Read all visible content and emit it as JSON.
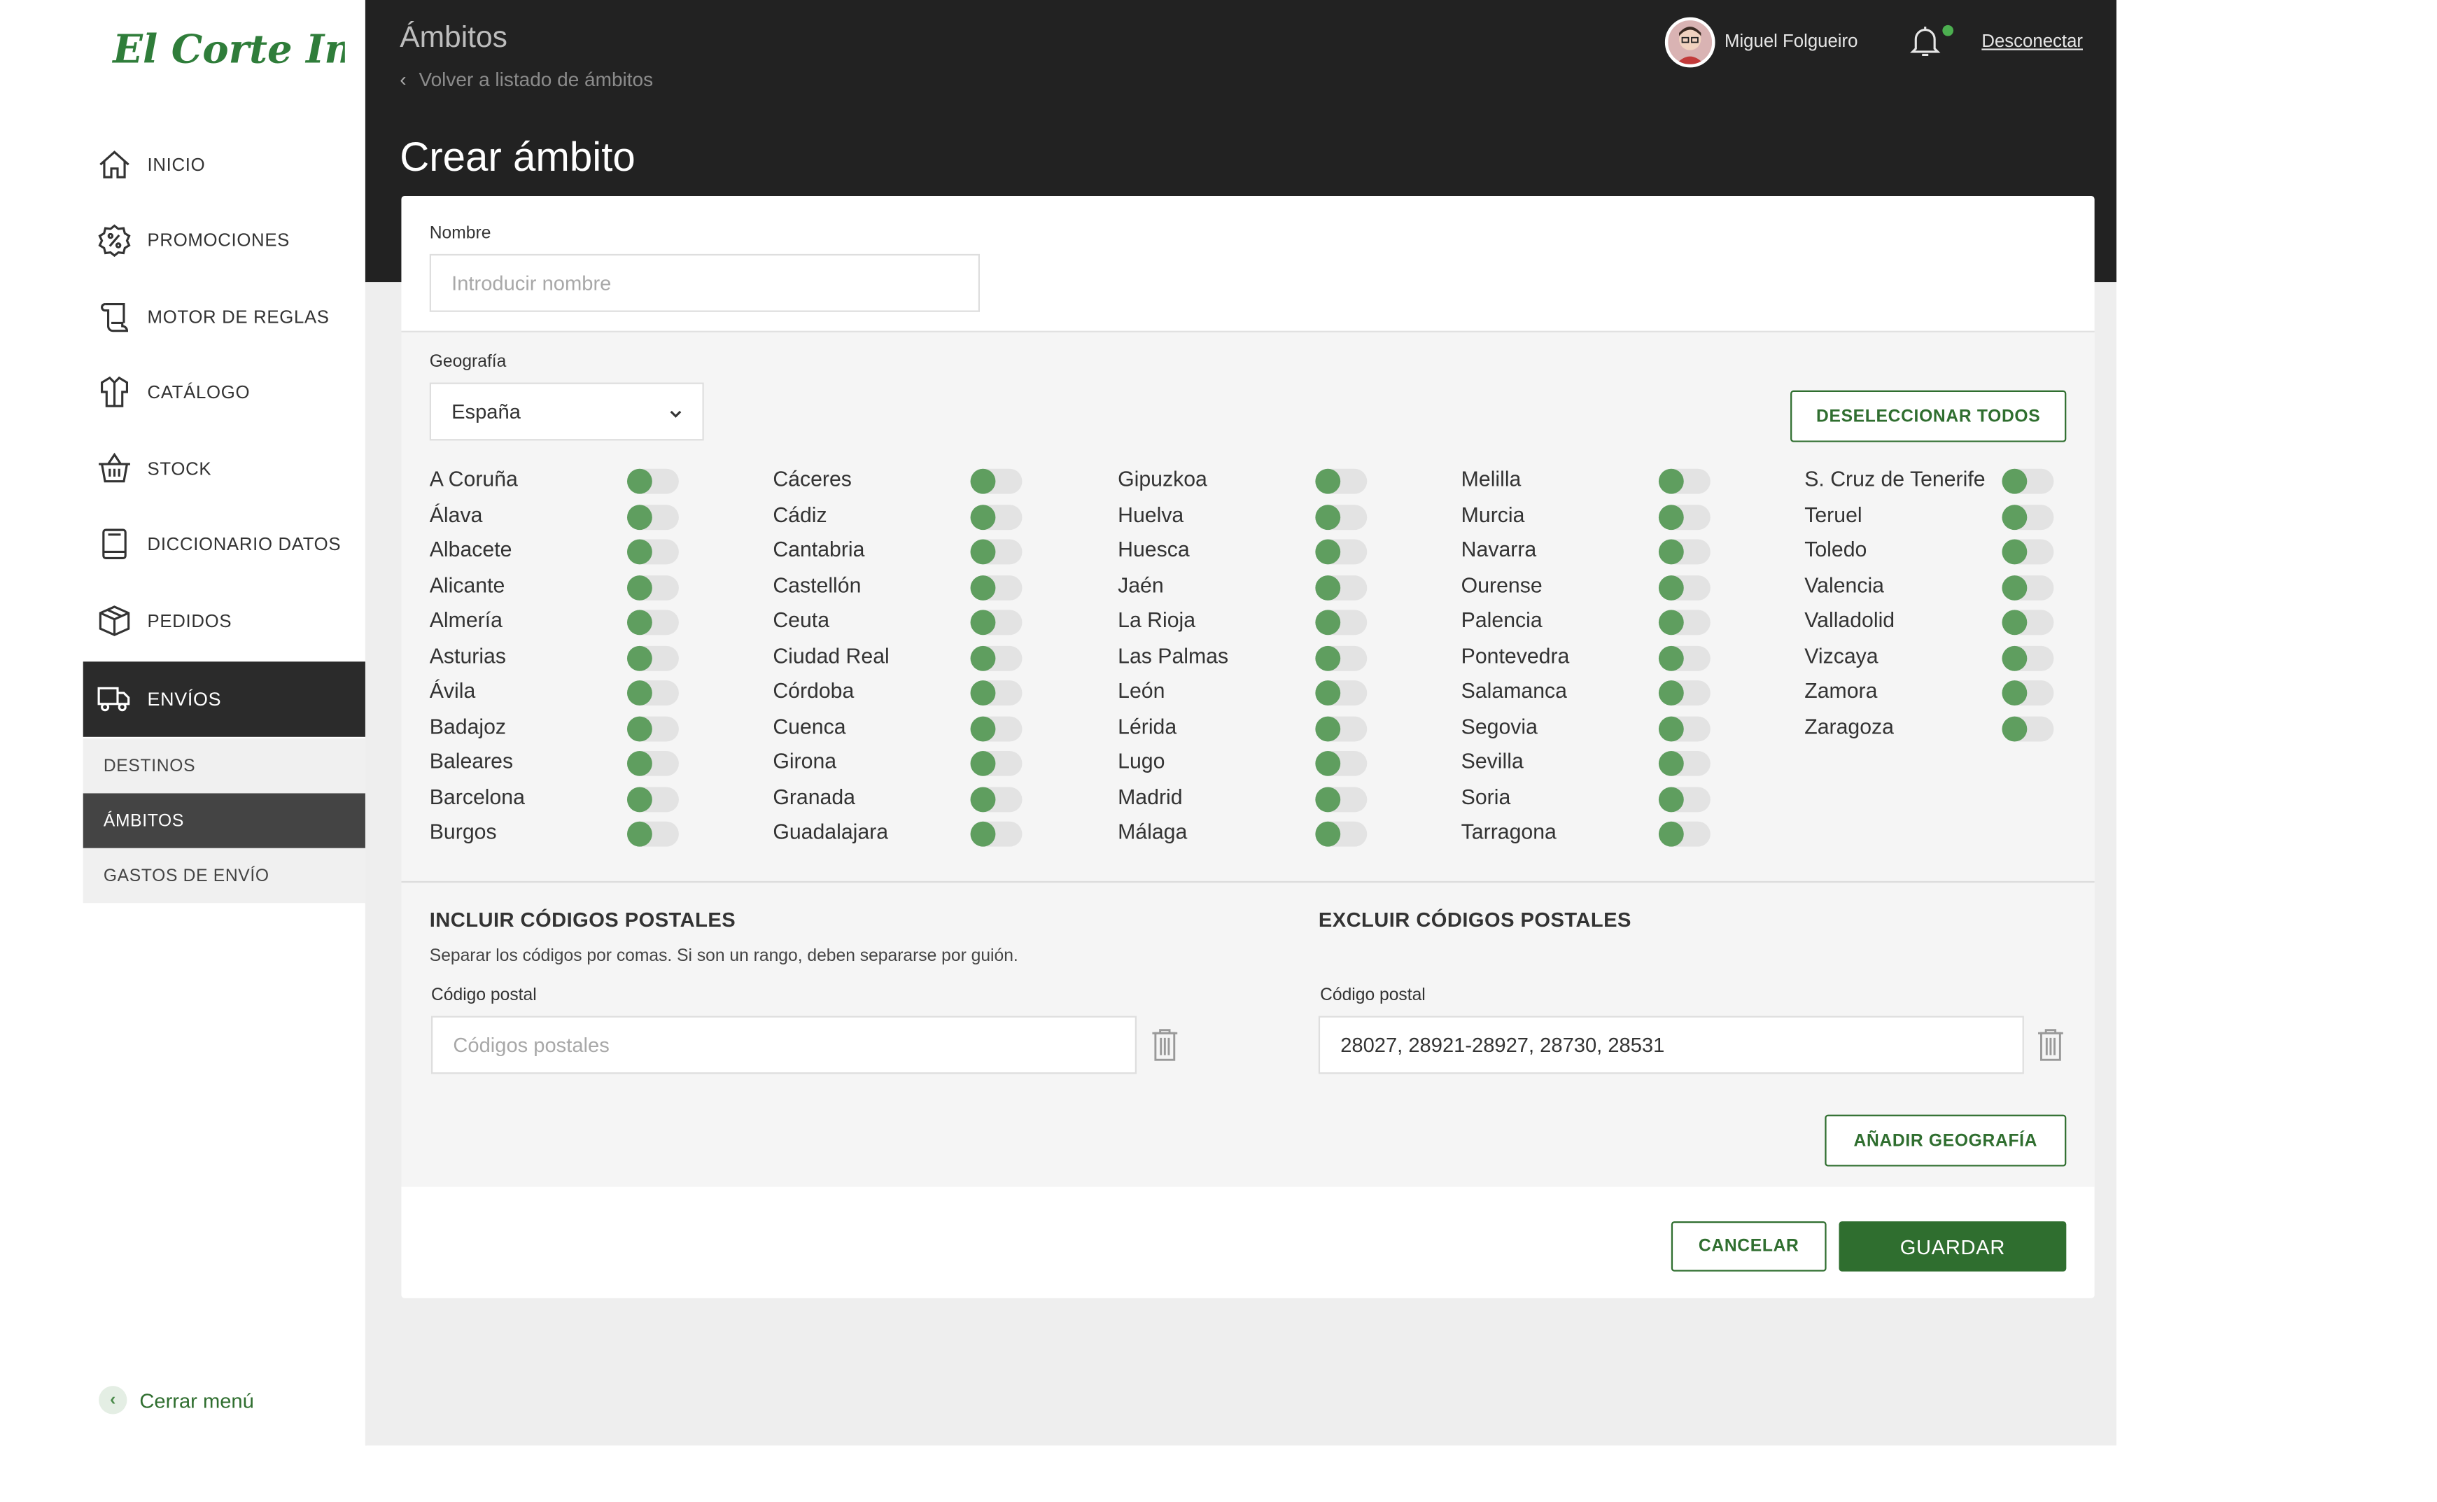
{
  "colors": {
    "brand_green": "#2f6e2f",
    "header_bg": "#222222",
    "toggle_on": "#5f9e5f"
  },
  "sidebar": {
    "logo_text": "El Corte Inglés",
    "items": [
      {
        "label": "INICIO",
        "icon": "home-icon"
      },
      {
        "label": "PROMOCIONES",
        "icon": "percent-badge-icon"
      },
      {
        "label": "MOTOR DE REGLAS",
        "icon": "scroll-icon"
      },
      {
        "label": "CATÁLOGO",
        "icon": "shirt-icon"
      },
      {
        "label": "STOCK",
        "icon": "basket-icon"
      },
      {
        "label": "DICCIONARIO DATOS",
        "icon": "book-icon"
      },
      {
        "label": "PEDIDOS",
        "icon": "box-icon"
      },
      {
        "label": "ENVÍOS",
        "icon": "truck-icon"
      }
    ],
    "subitems": [
      {
        "label": "DESTINOS"
      },
      {
        "label": "ÁMBITOS"
      },
      {
        "label": "GASTOS DE ENVÍO"
      }
    ],
    "close_menu": "Cerrar menú"
  },
  "header": {
    "section": "Ámbitos",
    "back": "Volver a listado de ámbitos",
    "title": "Crear ámbito",
    "user_name": "Miguel Folgueiro",
    "logout": "Desconectar"
  },
  "form": {
    "name_label": "Nombre",
    "name_placeholder": "Introducir nombre",
    "geo_label": "Geografía",
    "geo_value": "España",
    "deselect_all": "DESELECCIONAR TODOS",
    "provinces": [
      [
        "A Coruña",
        "Álava",
        "Albacete",
        "Alicante",
        "Almería",
        "Asturias",
        "Ávila",
        "Badajoz",
        "Baleares",
        "Barcelona",
        "Burgos"
      ],
      [
        "Cáceres",
        "Cádiz",
        "Cantabria",
        "Castellón",
        "Ceuta",
        "Ciudad Real",
        "Córdoba",
        "Cuenca",
        "Girona",
        "Granada",
        "Guadalajara"
      ],
      [
        "Gipuzkoa",
        "Huelva",
        "Huesca",
        "Jaén",
        "La Rioja",
        "Las Palmas",
        "León",
        "Lérida",
        "Lugo",
        "Madrid",
        "Málaga"
      ],
      [
        "Melilla",
        "Murcia",
        "Navarra",
        "Ourense",
        "Palencia",
        "Pontevedra",
        "Salamanca",
        "Segovia",
        "Sevilla",
        "Soria",
        "Tarragona"
      ],
      [
        "S. Cruz de Tenerife",
        "Teruel",
        "Toledo",
        "Valencia",
        "Valladolid",
        "Vizcaya",
        "Zamora",
        "Zaragoza"
      ]
    ],
    "include": {
      "title": "INCLUIR CÓDIGOS POSTALES",
      "hint": "Separar los códigos por comas. Si son un rango, deben separarse por guión.",
      "label": "Código postal",
      "placeholder": "Códigos postales"
    },
    "exclude": {
      "title": "EXCLUIR CÓDIGOS POSTALES",
      "label": "Código postal",
      "value": "28027, 28921-28927, 28730, 28531"
    },
    "add_geo": "AÑADIR GEOGRAFÍA",
    "cancel": "CANCELAR",
    "save": "GUARDAR"
  }
}
